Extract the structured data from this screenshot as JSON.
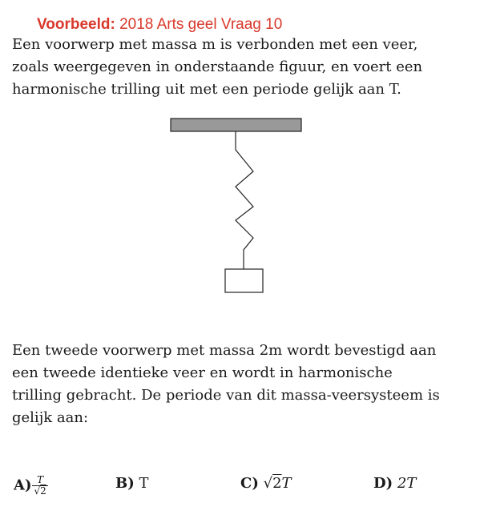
{
  "heading": {
    "label": "Voorbeeld:",
    "source": "2018 Arts geel Vraag 10"
  },
  "intro": {
    "lines": [
      "Een voorwerp met massa m is verbonden met een veer,",
      "zoals weergegeven in onderstaande figuur, en voert een",
      "harmonische trilling uit met een periode gelijk aan T."
    ]
  },
  "question": {
    "lines": [
      "Een tweede voorwerp met massa 2m wordt bevestigd aan",
      "een tweede identieke veer en wordt in harmonische",
      "trilling gebracht. De periode van dit massa-veersysteem is",
      "gelijk aan:"
    ]
  },
  "answers": {
    "a": {
      "letter": "A)",
      "numerator": "T",
      "denominator": "2"
    },
    "b": {
      "letter": "B)",
      "value": "T"
    },
    "c": {
      "letter": "C)",
      "radicand": "2",
      "suffix": "T"
    },
    "d": {
      "letter": "D)",
      "value": "2T"
    }
  },
  "colors": {
    "heading": "#d9382b",
    "ceiling_fill": "#999999"
  }
}
